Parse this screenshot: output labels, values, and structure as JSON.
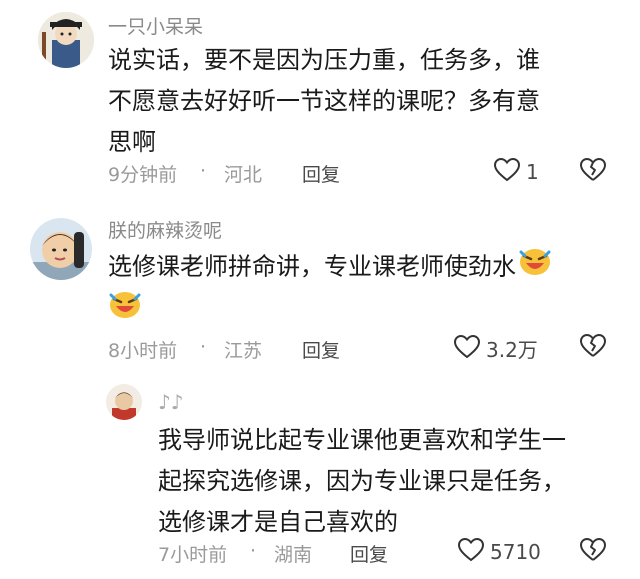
{
  "comments": [
    {
      "username": "一只小呆呆",
      "lines": [
        "说实话，要不是因为压力重，任务多，谁",
        "不愿意去好好听一节这样的课呢？多有意",
        "思啊"
      ],
      "time": "9分钟前",
      "location": "河北",
      "reply_label": "回复",
      "likes": "1"
    },
    {
      "username": "朕的麻辣烫呢",
      "lines": [
        "选修课老师拼命讲，专业课老师使劲水"
      ],
      "emoji": "laughing-crying-emoji",
      "time": "8小时前",
      "location": "江苏",
      "reply_label": "回复",
      "likes": "3.2万"
    },
    {
      "username": "♪♪",
      "lines": [
        "我导师说比起专业课他更喜欢和学生一",
        "起探究选修课，因为专业课只是任务，",
        "选修课才是自己喜欢的"
      ],
      "time": "7小时前",
      "location": "湖南",
      "reply_label": "回复",
      "likes": "5710"
    }
  ],
  "separator": "·",
  "colors": {
    "meta": "#9a9a9a",
    "username": "#8a8a8a",
    "text": "#1a1a1a"
  }
}
